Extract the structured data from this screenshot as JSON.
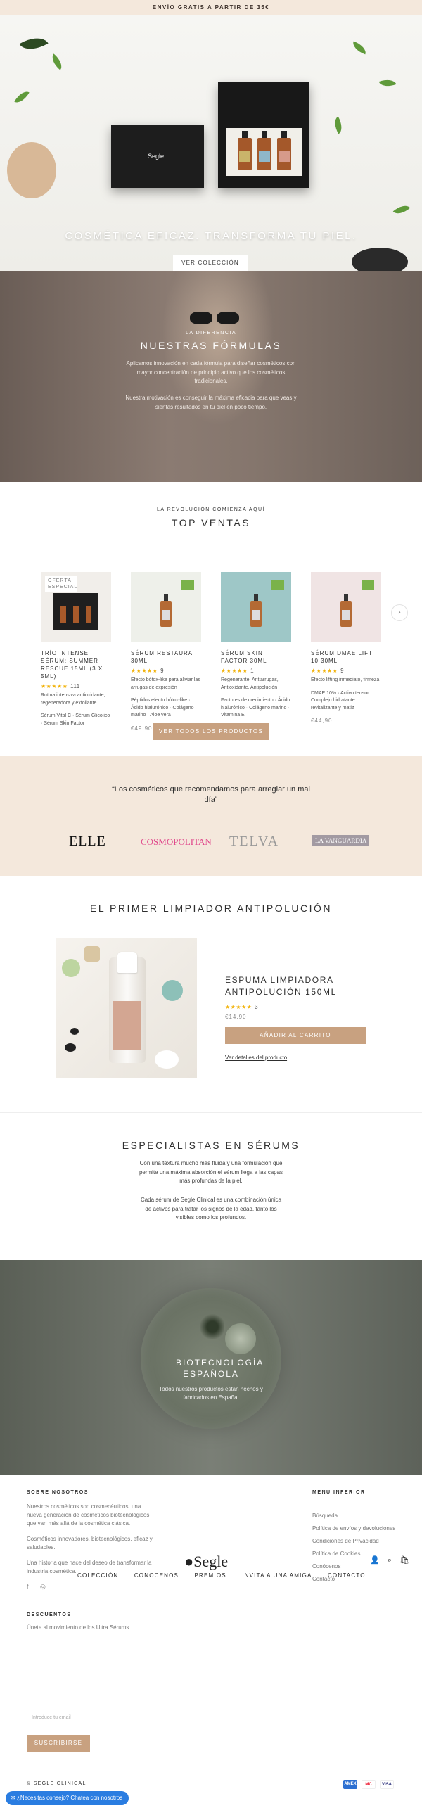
{
  "announcement": "ENVÍO GRATIS A PARTIR DE 35€",
  "header": {
    "brand": "Segle",
    "nav": [
      "COLECCIÓN",
      "CONOCENOS",
      "PREMIOS",
      "INVITA A UNA AMIGA",
      "CONTACTO"
    ]
  },
  "hero": {
    "box_logo": "Segle",
    "title": "COSMÉTICA EFICAZ. TRANSFORMA TU PIEL.",
    "button": "VER COLECCIÓN"
  },
  "difference": {
    "overline": "LA DIFERENCIA",
    "title": "NUESTRAS FÓRMULAS",
    "p1": "Aplicamos innovación en cada fórmula para diseñar cosméticos con mayor concentración de principio activo que los cosméticos tradicionales.",
    "p2": "Nuestra motivación es conseguir la máxima eficacia para que veas y sientas resultados en tu piel en poco tiempo."
  },
  "top_sales": {
    "overline": "LA REVOLUCIÓN COMIENZA AQUÍ",
    "title": "TOP VENTAS",
    "products": [
      {
        "badge": "OFERTA ESPECIAL",
        "name": "TRÍO INTENSE SÉRUM: SUMMER RESCUE 15ML (3 X 5ML)",
        "stars": "★★★★★",
        "reviews": "111",
        "desc1": "Rutina intensiva antioxidante, regeneradora y exfoliante",
        "desc2": "Sérum Vital C · Sérum Glicolico · Sérum Skin Factor",
        "price": ""
      },
      {
        "badge": "",
        "name": "SÉRUM RESTAURA 30ML",
        "stars": "★★★★★",
        "reviews": "9",
        "desc1": "Efecto bótox-like para aliviar las arrugas de expresión",
        "desc2": "Péptidos efecto bótox-like · Ácido hialurónico · Colágeno marino · Aloe vera",
        "price": "€49,90"
      },
      {
        "badge": "",
        "name": "SÉRUM SKIN FACTOR 30ML",
        "stars": "★★★★★",
        "reviews": "1",
        "desc1": "Regenerante, Antiarrugas, Antioxidante, Antipolución",
        "desc2": "Factores de crecimiento · Ácido hialurónico · Colágeno marino · Vitamina E",
        "price": "€49,90"
      },
      {
        "badge": "",
        "name": "SÉRUM DMAE LIFT 10 30ML",
        "stars": "★★★★★",
        "reviews": "9",
        "desc1": "Efecto lifting inmediato, firmeza",
        "desc2": "DMAE 10% · Activo tensor · Complejo hidratante revitalizante y matiz",
        "price": "€44,90"
      }
    ],
    "button": "VER TODOS LOS PRODUCTOS"
  },
  "press": {
    "quote": "“Los cosméticos que recomendamos para arreglar un mal día”",
    "logos": [
      "ELLE",
      "COSMOPOLITAN",
      "TELVA",
      "LA VANGUARDIA"
    ]
  },
  "featured": {
    "section_title": "EL PRIMER LIMPIADOR ANTIPOLUCIÓN",
    "product_name": "ESPUMA LIMPIADORA ANTIPOLUCIÓN 150ML",
    "stars": "★★★★★",
    "reviews": "3",
    "price": "€14,90",
    "add_to_cart": "AÑADIR AL CARRITO",
    "details_link": "Ver detalles del producto"
  },
  "specialists": {
    "title": "ESPECIALISTAS EN SÉRUMS",
    "p1": "Con una textura mucho más fluida y una formulación que permite una máxima absorción el sérum llega a las capas más profundas de la piel.",
    "p2": "Cada sérum de Segle Clinical es una combinación única de activos para tratar los signos de la edad, tanto los visibles como los profundos."
  },
  "bio": {
    "title": "BIOTECNOLOGÍA ESPAÑOLA",
    "text": "Todos nuestros productos están hechos y fabricados en España."
  },
  "footer": {
    "about_title": "SOBRE NOSOTROS",
    "about_p1": "Nuestros cosméticos son cosmecéuticos, una nueva generación de cosméticos biotecnológicos que van más allá de la cosmética clásica.",
    "about_p2": "Cosméticos innovadores, biotecnológicos, eficaz y saludables.",
    "about_p3": "Una historia que nace del deseo de transformar la industria cosmética.",
    "discounts_title": "DESCUENTOS",
    "discounts_text": "Únete al movimiento de los Ultra Sérums.",
    "email_placeholder": "Introduce tu email",
    "subscribe": "SUSCRIBIRSE",
    "menu_title": "MENÚ INFERIOR",
    "menu": [
      "Búsqueda",
      "Política de envíos y devoluciones",
      "Condiciones de Privacidad",
      "Política de Cookies",
      "Conócenos",
      "Contacto"
    ],
    "copyright": "© SEGLE CLINICAL",
    "payments": [
      "AMEX",
      "MC",
      "VISA"
    ]
  },
  "chat": "¿Necesitas consejo? Chatea con nosotros",
  "colors": {
    "accent": "#c8a180",
    "announce_bg": "#f4e8dc",
    "star": "#f2b30b"
  }
}
